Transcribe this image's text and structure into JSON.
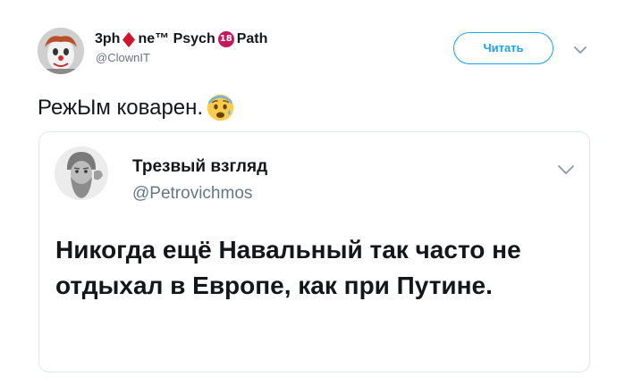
{
  "tweet": {
    "author": {
      "name_part1": "3ph",
      "name_part2": "ne™ Psych",
      "name_part3": "Path",
      "badge_text": "18",
      "handle": "@ClownIT"
    },
    "follow_label": "Читать",
    "text": "РежЫм коварен.",
    "icons": {
      "name_symbol": "diamond-icon",
      "emoji": "anxious-face-icon",
      "menu": "chevron-down-icon"
    },
    "colors": {
      "accent": "#1da1f2",
      "secondary_text": "#657786",
      "border": "#e1e8ed",
      "diamond": "#d0142c",
      "badge": "#c2185b"
    }
  },
  "quoted_tweet": {
    "author_name": "Трезвый взгляд",
    "handle": "@Petrovichmos",
    "text": "Никогда ещё Навальный так часто не отдыхал в Европе, как при Путине."
  }
}
